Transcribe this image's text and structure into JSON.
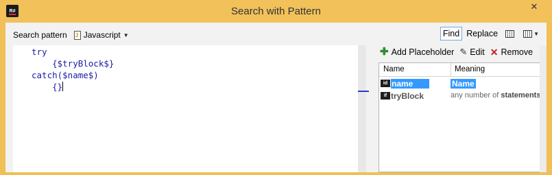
{
  "window": {
    "title": "Search with Pattern",
    "app_icon_text": "R#",
    "close_glyph": "✕"
  },
  "toolbar": {
    "search_pattern_label": "Search pattern",
    "language": "Javascript",
    "find_label": "Find",
    "replace_label": "Replace"
  },
  "editor": {
    "lines": [
      "try",
      "    {$tryBlock$}",
      "catch($name$)",
      "    {}"
    ]
  },
  "placeholders": {
    "actions": {
      "add_label": "Add Placeholder",
      "edit_label": "Edit",
      "remove_label": "Remove"
    },
    "columns": {
      "name": "Name",
      "meaning": "Meaning"
    },
    "rows": [
      {
        "icon_text": "id",
        "name": "name",
        "meaning": "Name",
        "meaning_extra": ""
      },
      {
        "icon_text": "if",
        "name": "tryBlock",
        "meaning": "any number of ",
        "meaning_extra": "statements"
      }
    ]
  },
  "colors": {
    "title_bar": "#f2c15a",
    "selection": "#3399ff",
    "keyword": "#1a1aa6"
  }
}
